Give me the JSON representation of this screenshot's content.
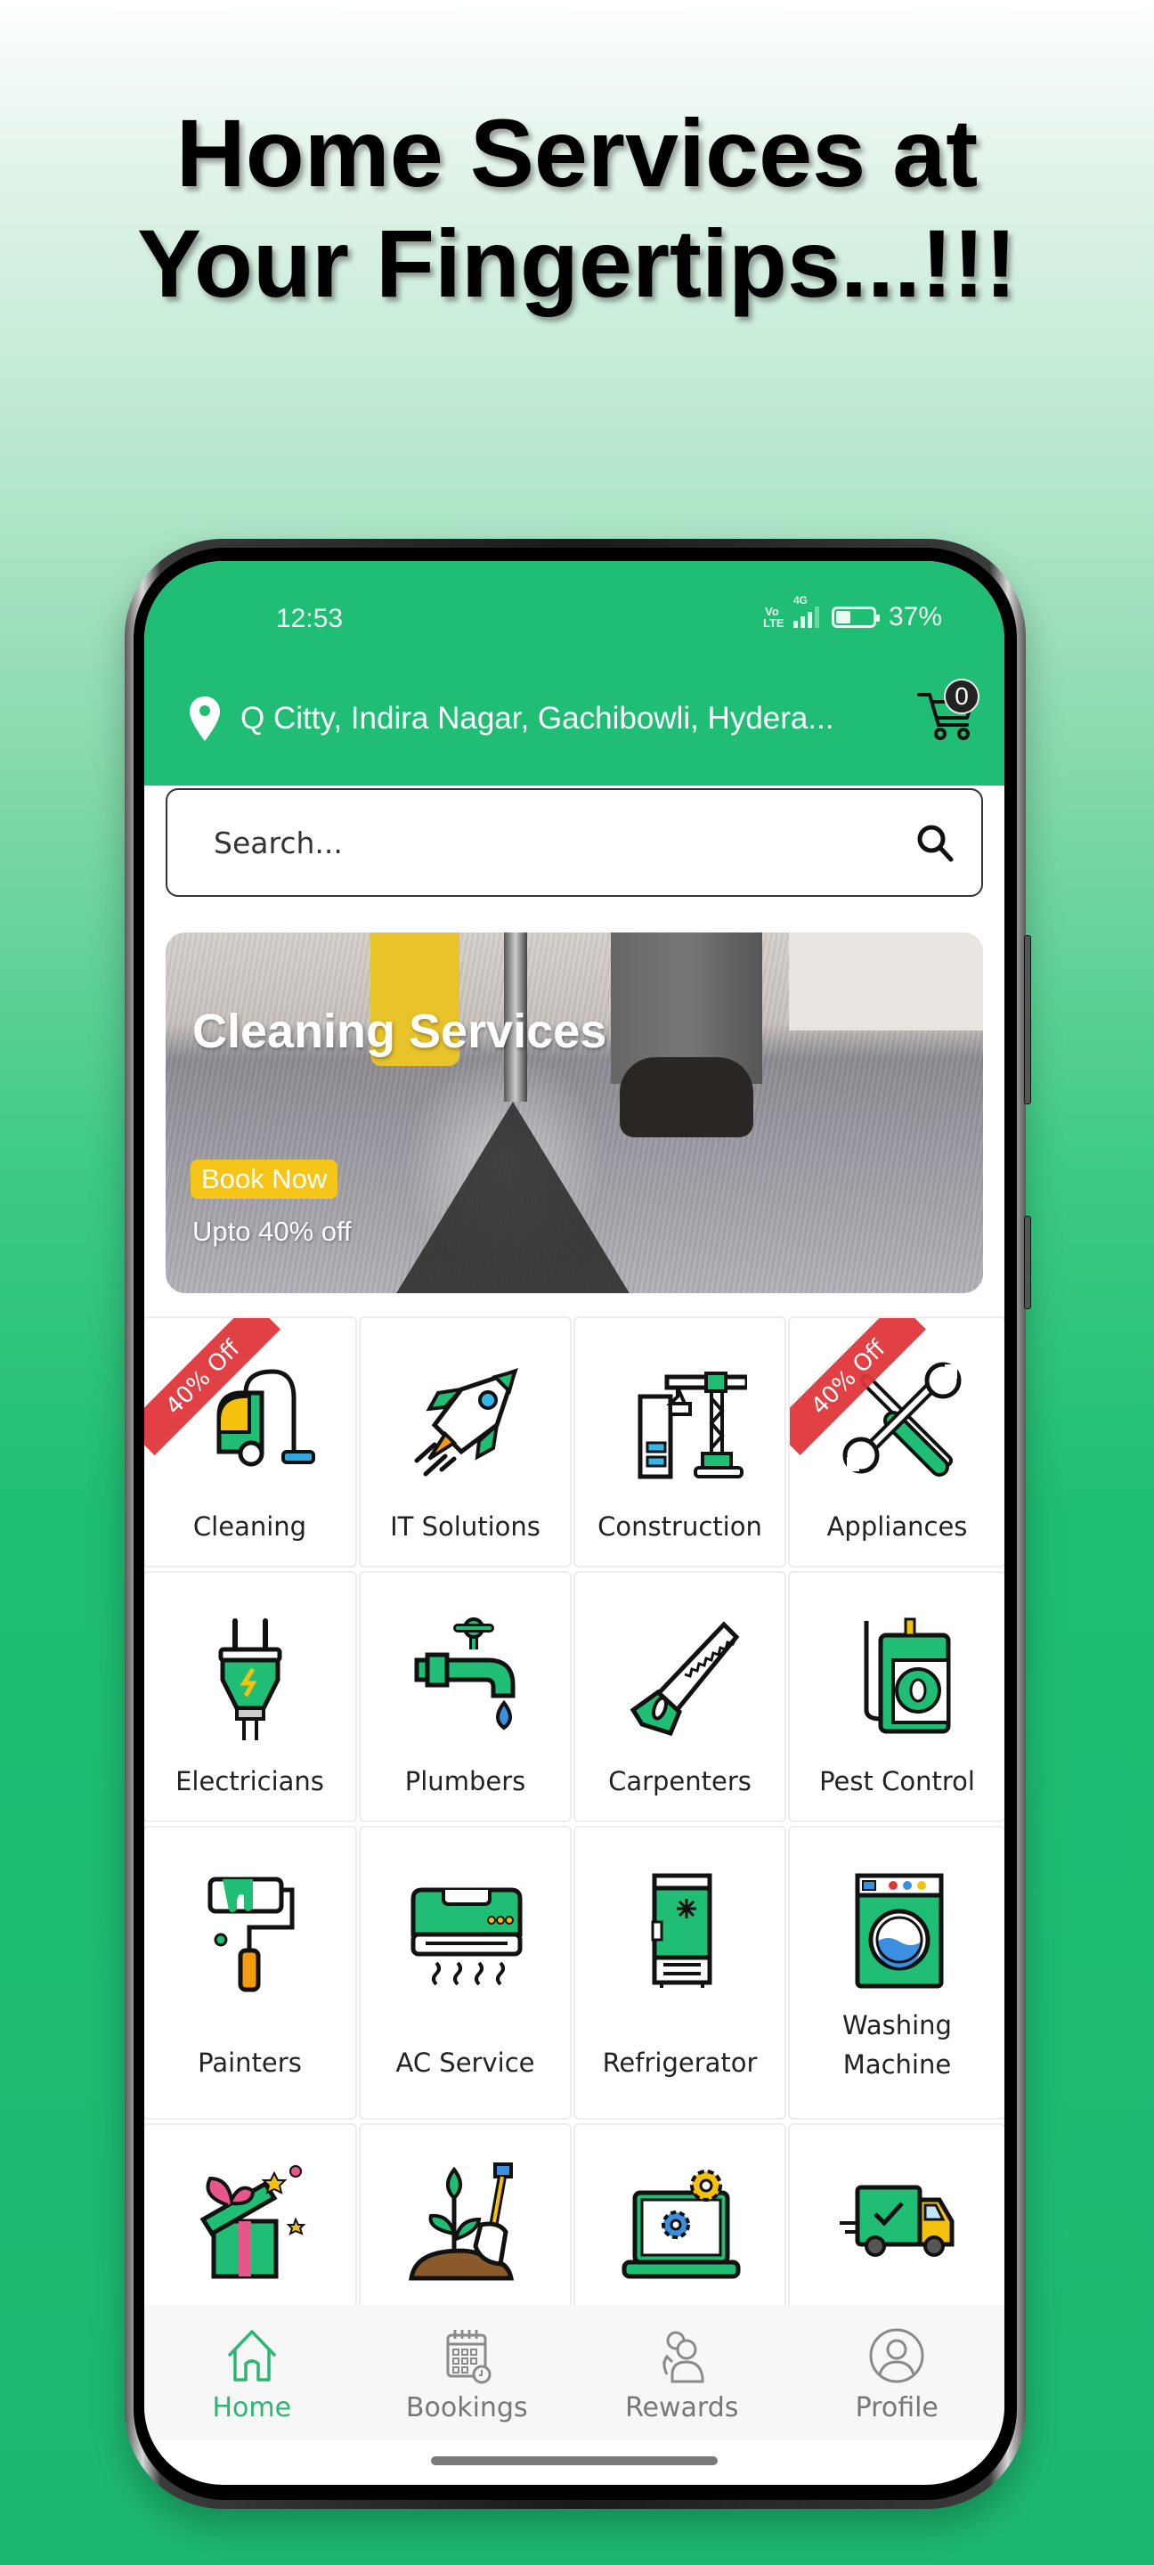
{
  "promo": {
    "headline_line1": "Home Services at",
    "headline_line2": "Your Fingertips...!!!"
  },
  "status_bar": {
    "time": "12:53",
    "volte_top": "Vo",
    "volte_bottom": "LTE",
    "network": "4G",
    "battery_percent_text": "37%",
    "battery_level": 0.37
  },
  "header": {
    "location": "Q Citty, Indira Nagar, Gachibowli, Hydera...",
    "cart_count": "0",
    "icons": {
      "location": "map-pin-icon",
      "cart": "shopping-cart-icon"
    }
  },
  "search": {
    "placeholder": "Search...",
    "value": "",
    "icon": "search-icon"
  },
  "banner": {
    "title": "Cleaning Services",
    "cta_label": "Book Now",
    "subtitle": "Upto 40% off"
  },
  "categories": [
    {
      "label": "Cleaning",
      "icon": "vacuum-cleaner-icon",
      "badge": "40% Off"
    },
    {
      "label": "IT Solutions",
      "icon": "rocket-icon",
      "badge": ""
    },
    {
      "label": "Construction",
      "icon": "crane-icon",
      "badge": ""
    },
    {
      "label": "Appliances",
      "icon": "wrench-screwdriver-icon",
      "badge": "40% Off"
    },
    {
      "label": "Electricians",
      "icon": "plug-icon",
      "badge": ""
    },
    {
      "label": "Plumbers",
      "icon": "faucet-icon",
      "badge": ""
    },
    {
      "label": "Carpenters",
      "icon": "hand-saw-icon",
      "badge": ""
    },
    {
      "label": "Pest Control",
      "icon": "pest-sprayer-icon",
      "badge": ""
    },
    {
      "label": "Painters",
      "icon": "paint-roller-icon",
      "badge": ""
    },
    {
      "label": "AC Service",
      "icon": "air-conditioner-icon",
      "badge": ""
    },
    {
      "label": "Refrigerator",
      "icon": "refrigerator-icon",
      "badge": ""
    },
    {
      "label": "Washing Machine",
      "label_line1": "Washing",
      "label_line2": "Machine",
      "icon": "washing-machine-icon",
      "badge": ""
    },
    {
      "label": "",
      "icon": "gift-box-icon",
      "badge": ""
    },
    {
      "label": "",
      "icon": "gardening-plant-shovel-icon",
      "badge": ""
    },
    {
      "label": "",
      "icon": "laptop-gears-icon",
      "badge": ""
    },
    {
      "label": "",
      "icon": "delivery-truck-icon",
      "badge": ""
    }
  ],
  "bottom_nav": [
    {
      "label": "Home",
      "icon": "home-icon",
      "active": true
    },
    {
      "label": "Bookings",
      "icon": "calendar-clock-icon",
      "active": false
    },
    {
      "label": "Rewards",
      "icon": "users-refer-icon",
      "active": false
    },
    {
      "label": "Profile",
      "icon": "user-circle-icon",
      "active": false
    }
  ],
  "colors": {
    "brand_green": "#20bd74",
    "active_nav": "#2bb673",
    "inactive_nav": "#777777",
    "ribbon_red": "#e0363a",
    "cta_yellow": "#f5c518"
  }
}
